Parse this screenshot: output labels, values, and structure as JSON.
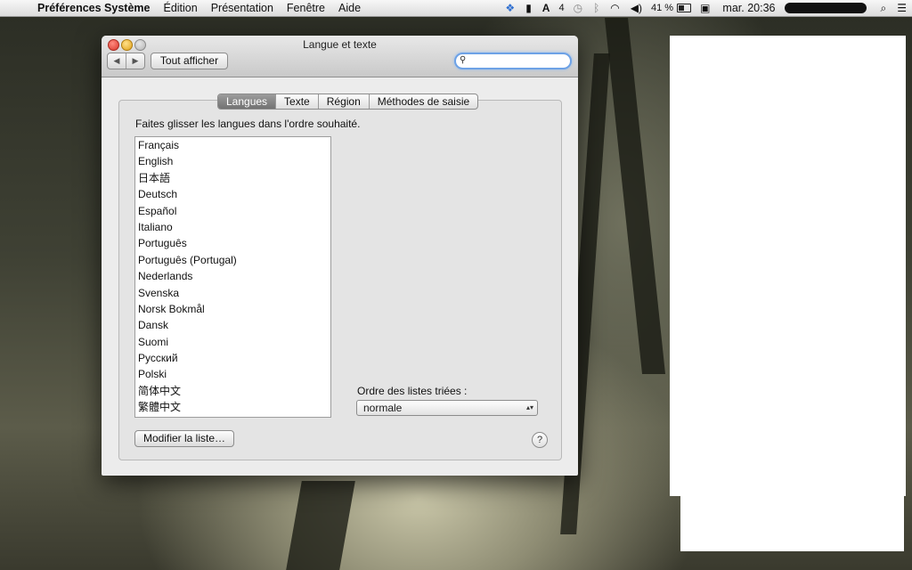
{
  "menubar": {
    "app_name": "Préférences Système",
    "menus": [
      "Édition",
      "Présentation",
      "Fenêtre",
      "Aide"
    ],
    "status": {
      "notification_count": "4",
      "battery": "41 %",
      "clock": "mar. 20:36"
    }
  },
  "window": {
    "title": "Langue et texte",
    "back_label": "◀",
    "forward_label": "▶",
    "show_all_label": "Tout afficher",
    "search": {
      "value": "",
      "placeholder": ""
    }
  },
  "tabs": [
    {
      "label": "Langues",
      "active": true
    },
    {
      "label": "Texte",
      "active": false
    },
    {
      "label": "Région",
      "active": false
    },
    {
      "label": "Méthodes de saisie",
      "active": false
    }
  ],
  "languages_panel": {
    "instruction": "Faites glisser les langues dans l'ordre souhaité.",
    "languages": [
      "Français",
      "English",
      "日本語",
      "Deutsch",
      "Español",
      "Italiano",
      "Português",
      "Português (Portugal)",
      "Nederlands",
      "Svenska",
      "Norsk Bokmål",
      "Dansk",
      "Suomi",
      "Русский",
      "Polski",
      "简体中文",
      "繁體中文"
    ],
    "sort_order_label": "Ordre des listes triées :",
    "sort_order_value": "normale",
    "modify_list_label": "Modifier la liste…",
    "help_label": "?"
  },
  "colors": {
    "active_tab": "#7f7f7f",
    "search_focus": "#6da2e6"
  }
}
